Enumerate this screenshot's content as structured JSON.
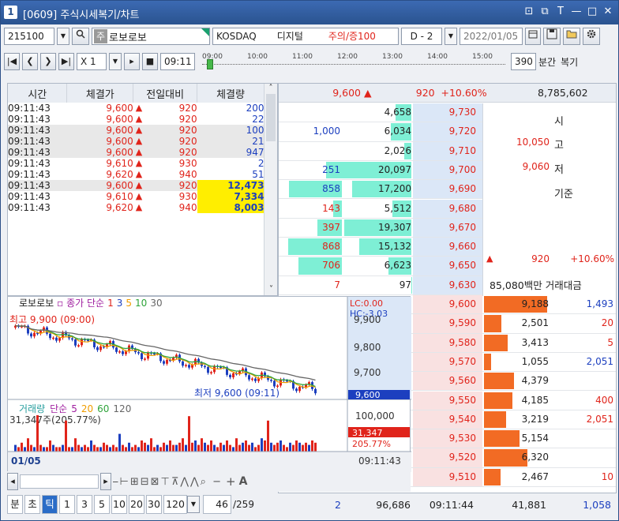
{
  "window": {
    "num": "1",
    "title": "[0609] 주식시세복기/차트",
    "buttons": [
      "⊡",
      "⧉",
      "T",
      "—",
      "□",
      "✕"
    ]
  },
  "toolbar1": {
    "code": "215100",
    "type_badge": "주",
    "name": "로보로보",
    "market": "KOSDAQ",
    "sector": "디지털",
    "warn": "주의/증100",
    "day_sel": "D - 2",
    "date": "2022/01/05"
  },
  "toolbar2": {
    "speed": "X 1",
    "time": "09:11",
    "timeline_ticks": [
      "09:00",
      "10:00",
      "11:00",
      "12:00",
      "13:00",
      "14:00",
      "15:00"
    ],
    "minutes": "390",
    "minutes_unit": "분간",
    "replay_label": "복기"
  },
  "tick": {
    "headers": [
      "시간",
      "체결가",
      "전일대비",
      "체결량"
    ],
    "rows": [
      [
        "09:11:43",
        "9,600",
        "920",
        "200",
        false
      ],
      [
        "09:11:43",
        "9,600",
        "920",
        "22",
        false
      ],
      [
        "09:11:43",
        "9,600",
        "920",
        "100",
        false
      ],
      [
        "09:11:43",
        "9,600",
        "920",
        "21",
        false
      ],
      [
        "09:11:43",
        "9,600",
        "920",
        "947",
        false
      ],
      [
        "09:11:43",
        "9,610",
        "930",
        "2",
        false
      ],
      [
        "09:11:43",
        "9,620",
        "940",
        "51",
        false
      ],
      [
        "09:11:43",
        "9,600",
        "920",
        "12,473",
        true
      ],
      [
        "09:11:43",
        "9,610",
        "930",
        "7,334",
        true
      ],
      [
        "09:11:43",
        "9,620",
        "940",
        "8,003",
        true
      ]
    ]
  },
  "orderbook": {
    "header": {
      "price": "9,600",
      "diff": "920",
      "pct": "+10.60%",
      "volume": "8,785,602"
    },
    "asks": [
      [
        "",
        "4,658",
        "9,730"
      ],
      [
        "1,000",
        "6,034",
        "9,720"
      ],
      [
        "",
        "2,026",
        "9,710"
      ],
      [
        "251",
        "20,097",
        "9,700"
      ],
      [
        "858",
        "17,200",
        "9,690"
      ],
      [
        "143",
        "5,512",
        "9,680"
      ],
      [
        "397",
        "19,307",
        "9,670"
      ],
      [
        "868",
        "15,132",
        "9,660"
      ],
      [
        "706",
        "6,623",
        "9,650"
      ],
      [
        "7",
        "97",
        "9,630"
      ]
    ],
    "bids": [
      [
        "9,600",
        "9,188",
        "1,493"
      ],
      [
        "9,590",
        "2,501",
        "20"
      ],
      [
        "9,580",
        "3,413",
        "5"
      ],
      [
        "9,570",
        "1,055",
        "2,051"
      ],
      [
        "9,560",
        "4,379",
        ""
      ],
      [
        "9,550",
        "4,185",
        "400"
      ],
      [
        "9,540",
        "3,219",
        "2,051"
      ],
      [
        "9,530",
        "5,154",
        ""
      ],
      [
        "9,520",
        "6,320",
        ""
      ],
      [
        "9,510",
        "2,467",
        "10"
      ]
    ],
    "info": {
      "open_label": "시",
      "high_val": "10,050",
      "high_label": "고",
      "low_val": "9,060",
      "low_label": "저",
      "base_label": "기준",
      "diff": "920",
      "pct": "+10.60%",
      "amount": "85,080백만",
      "amount_label": "거래대금"
    },
    "footer": {
      "c1": "2",
      "c2": "96,686",
      "time": "09:11:44",
      "c3": "41,881",
      "c4": "1,058"
    }
  },
  "chart": {
    "legend_name": "로보로보",
    "legend_ma": "종가 단순",
    "ma": [
      "1",
      "3",
      "5",
      "10",
      "30"
    ],
    "max_label": "최고 9,900 (09:00)",
    "min_label": "최저 9,600 (09:11)",
    "lc": "LC:0.00",
    "hc": "HC:-3.03",
    "yticks": [
      "9,900",
      "9,800",
      "9,700"
    ],
    "cur_price": "9,600",
    "vol_legend": "거래량",
    "vol_ma": "단순",
    "vol_mas": [
      "5",
      "20",
      "60",
      "120"
    ],
    "vol_max": "31,347주(205.77%)",
    "vol_tick": "100,000",
    "vol_cur": "31,347",
    "vol_pct": "205.77%",
    "date": "01/05",
    "time": "09:11:43",
    "colors": {
      "up": "#e0241b",
      "down": "#1c3fbf",
      "ma1": "#e0241b",
      "ma3": "#1c3fbf",
      "ma5": "#f09d00",
      "ma10": "#2fa43a",
      "ma30": "#666666"
    }
  },
  "bottom": {
    "tabs": [
      "분",
      "초",
      "틱",
      "1",
      "3",
      "5",
      "10",
      "20",
      "30",
      "120"
    ],
    "selected": "틱",
    "page": "46",
    "total": "/259"
  }
}
